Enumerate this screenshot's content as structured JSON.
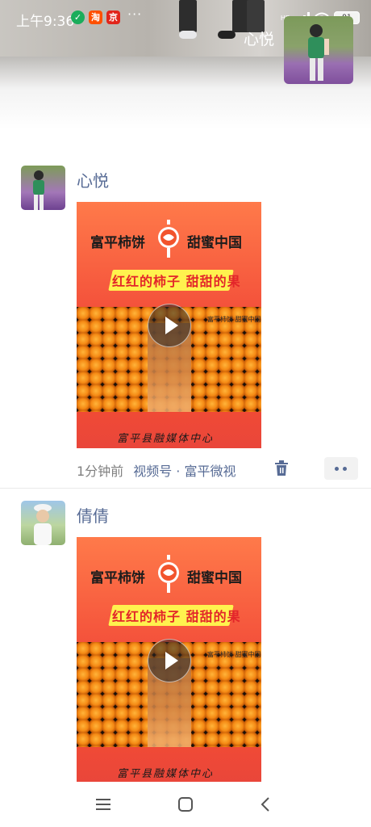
{
  "status_bar": {
    "time": "上午9:36",
    "app_badges": [
      "淘",
      "京"
    ],
    "overflow": "···",
    "network": "HD",
    "battery": "91"
  },
  "cover": {
    "user_name": "心悦"
  },
  "posts": [
    {
      "author": "心悦",
      "video": {
        "title_left": "富平柿饼",
        "title_right": "甜蜜中国",
        "subtitle": "红红的柿子 甜甜的果",
        "corner_text": "富平柿饼 甜蜜中国",
        "footer": "富平县融媒体中心"
      },
      "time": "1分钟前",
      "source": "视频号 · 富平微视",
      "has_delete": true
    },
    {
      "author": "倩倩",
      "video": {
        "title_left": "富平柿饼",
        "title_right": "甜蜜中国",
        "subtitle": "红红的柿子 甜甜的果",
        "corner_text": "富平柿饼 甜蜜中国",
        "footer": "富平县融媒体中心"
      }
    }
  ],
  "nav": {
    "icons": [
      "menu-icon",
      "home-icon",
      "back-icon"
    ]
  },
  "colors": {
    "link": "#576b95",
    "meta": "#7f7f7f",
    "video_bg": "#f4523b",
    "subtitle_bg": "#fff24e"
  }
}
